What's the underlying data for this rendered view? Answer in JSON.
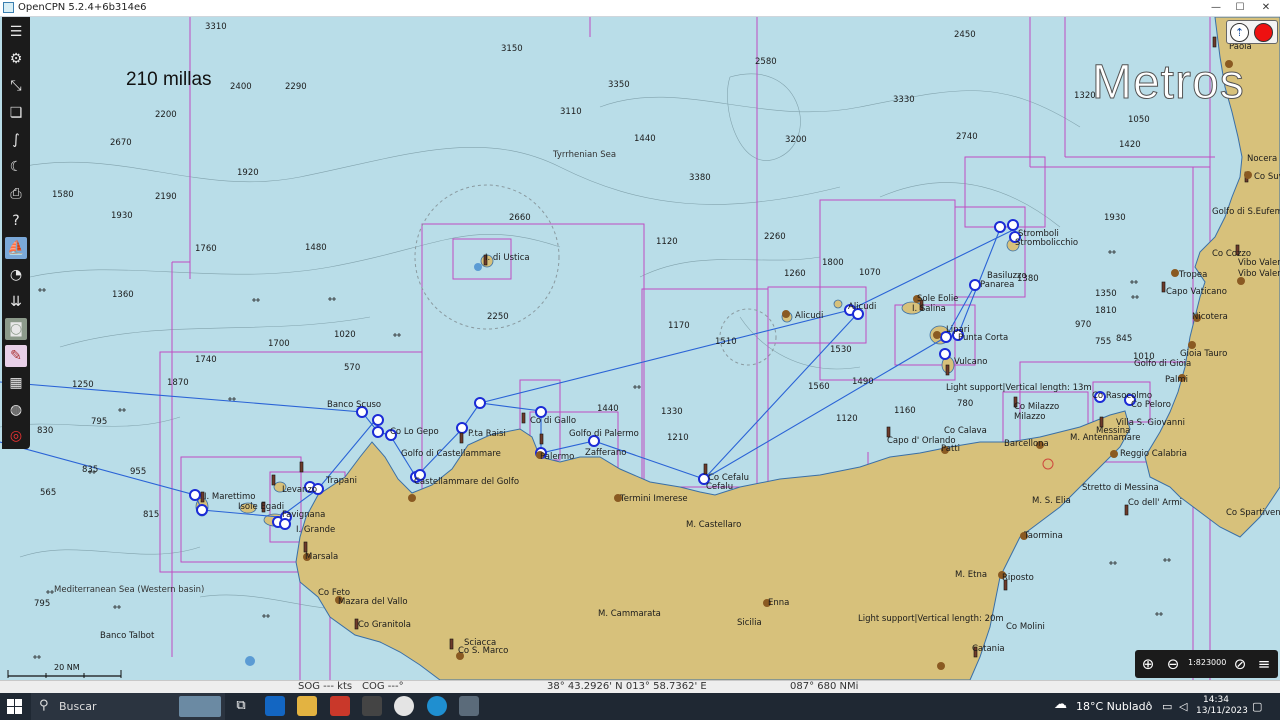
{
  "window": {
    "title": "OpenCPN 5.2.4+6b314e6",
    "min": "—",
    "max": "☐",
    "close": "✕"
  },
  "overlay": {
    "distance": "210 millas",
    "units": "Metros"
  },
  "map_labels": {
    "sea": [
      "Tyrrhenian Sea",
      "Mediterranean Sea (Western basin)"
    ],
    "places": [
      "Paola",
      "Nocera",
      "Co Suvero",
      "Golfo di S.Eufemia",
      "Co Cozzo",
      "Vibo Valentia",
      "Vibo Valentia",
      "Tropea",
      "Capo Vaticano",
      "Nicotera",
      "Gioia Tauro",
      "Golfo di Gioia",
      "Palmi",
      "Stromboli",
      "Strombolicchio",
      "Basiluzzo",
      "Panarea",
      "Sole Eolie",
      "I. Salina",
      "Alicudi",
      "Alicudi",
      "Lipari",
      "Punta Corta",
      "Vulcano",
      "Light support|Vertical length: 13m",
      "Co Milazzo",
      "Milazzo",
      "Co Rasocolmo",
      "Co Peloro",
      "Villa S. Giovanni",
      "M. Antennamare",
      "Reggio Calabria",
      "Messina",
      "Stretto di Messina",
      "Co dell' Armi",
      "Co Spartivento",
      "Barcellona",
      "Capo d' Orlando",
      "Co Calava",
      "Patti",
      "I. di Ustica",
      "Banco Scuso",
      "Co Lo Gepo",
      "Golfo di Castellammare",
      "Castellammare del Golfo",
      "P.ta Raisi",
      "Co di Gallo",
      "Golfo di Palermo",
      "Palermo",
      "Zafferano",
      "Termini Imerese",
      "Co Cefalu",
      "Cefalu",
      "M. Castellaro",
      "I. Marettimo",
      "Isole Egadi",
      "Levanzo",
      "Favignana",
      "I. Grande",
      "Trapani",
      "Marsala",
      "Co Feto",
      "Mazara del Vallo",
      "Co Granitola",
      "Sciacca",
      "Co S. Marco",
      "M. Cammarata",
      "Enna",
      "Sicilia",
      "M. S. Elia",
      "Taormina",
      "M. Etna",
      "Riposto",
      "Light support|Vertical length: 20m",
      "Co Molini",
      "Catania",
      "Banco Talbot"
    ],
    "depths": [
      "3310",
      "3150",
      "2580",
      "2400",
      "2290",
      "3350",
      "2200",
      "3110",
      "2670",
      "1440",
      "3380",
      "3200",
      "3330",
      "2450",
      "2740",
      "1920",
      "2190",
      "1320",
      "1580",
      "1930",
      "1760",
      "1480",
      "2660",
      "1120",
      "2260",
      "1260",
      "1380",
      "1070",
      "1360",
      "1930",
      "2250",
      "1170",
      "1510",
      "1800",
      "1530",
      "1700",
      "1020",
      "1740",
      "1870",
      "570",
      "1490",
      "1560",
      "1250",
      "1440",
      "1330",
      "1210",
      "1120",
      "1160",
      "780",
      "1810",
      "755",
      "815",
      "835",
      "565",
      "795",
      "1420",
      "1050",
      "970",
      "1010",
      "845",
      "1350",
      "830",
      "795",
      "955"
    ]
  },
  "scale": {
    "label": "20 NM",
    "value": "1:823000"
  },
  "status": {
    "sog": "SOG --- kts",
    "cog": "COG ---°",
    "position": "38° 43.2926' N   013° 58.7362' E",
    "bearing": "087°  680 NMi"
  },
  "taskbar": {
    "search_placeholder": "Buscar",
    "weather": "18°C  Nublado",
    "time": "14:34",
    "date": "13/11/2023"
  },
  "colors": {
    "sea": "#b9dde8",
    "land": "#d7c17b",
    "chart_border": "#c04cc2",
    "route": "#2a63d6",
    "waypoint": "#6a2ab0"
  }
}
